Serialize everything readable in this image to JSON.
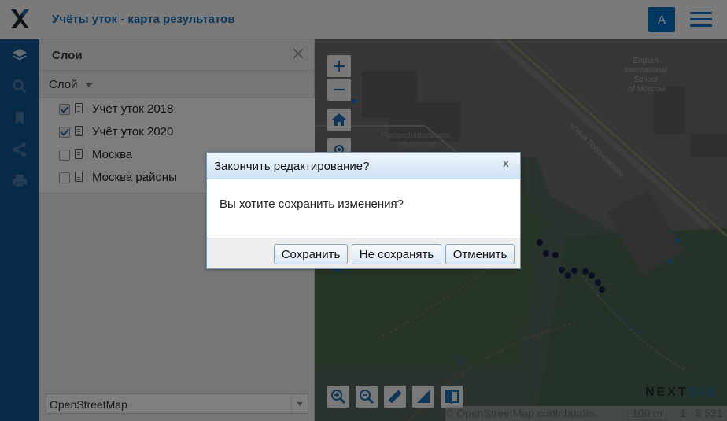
{
  "header": {
    "title": "Учёты уток - карта результатов",
    "avatar_letter": "A"
  },
  "sidebar": {
    "tools": [
      "layers-icon",
      "search-icon",
      "bookmark-icon",
      "share-icon",
      "print-icon"
    ]
  },
  "layers_panel": {
    "title": "Слои",
    "layer_dropdown_label": "Слой",
    "layers": [
      {
        "name": "Учёт уток 2018",
        "checked": true
      },
      {
        "name": "Учёт уток 2020",
        "checked": true
      },
      {
        "name": "Москва",
        "checked": false
      },
      {
        "name": "Москва районы",
        "checked": false
      }
    ],
    "basemap": "OpenStreetMap"
  },
  "map": {
    "labels": {
      "school": [
        "English",
        "International",
        "School",
        "of Moscow"
      ],
      "street": "улица Лобачевского",
      "coop": [
        "Потребительское",
        "общество"
      ]
    },
    "attribution": "© OpenStreetMap contributors.",
    "scale_label": "100 m",
    "scale_ratio": "1 : 8 531",
    "logo": "NEXTGIS"
  },
  "dialog": {
    "title": "Закончить редактирование?",
    "close_symbol": "x",
    "message": "Вы хотите сохранить изменения?",
    "buttons": {
      "save": "Сохранить",
      "dont_save": "Не сохранять",
      "cancel": "Отменить"
    }
  }
}
